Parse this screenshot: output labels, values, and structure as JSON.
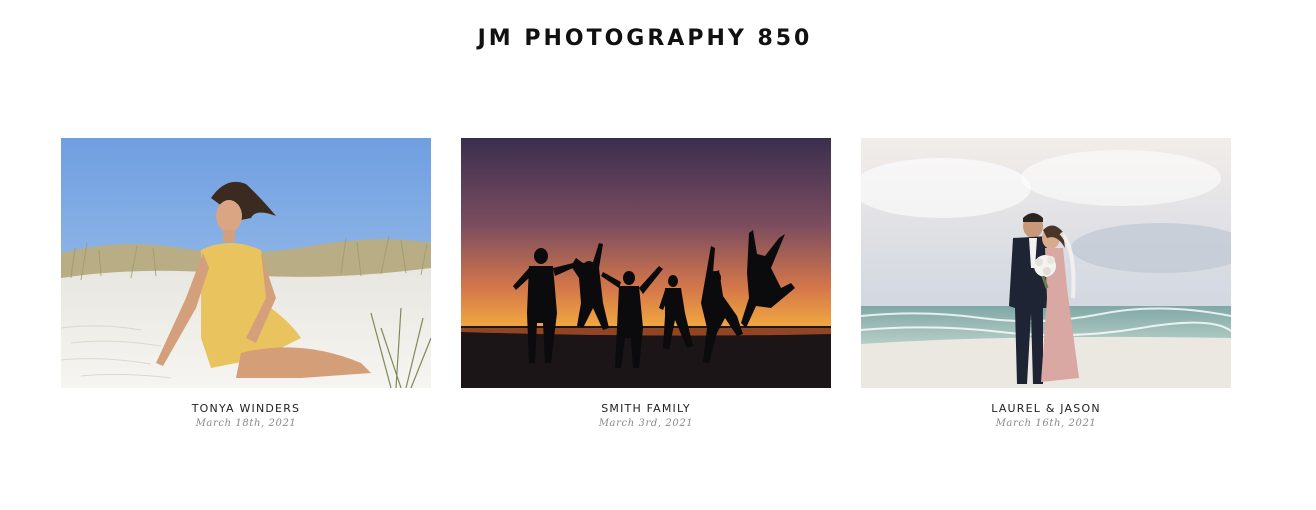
{
  "site": {
    "title": "JM PHOTOGRAPHY 850"
  },
  "galleries": [
    {
      "title": "TONYA WINDERS",
      "date": "March 18th, 2021"
    },
    {
      "title": "SMITH FAMILY",
      "date": "March 3rd, 2021"
    },
    {
      "title": "LAUREL & JASON",
      "date": "March 16th, 2021"
    }
  ]
}
